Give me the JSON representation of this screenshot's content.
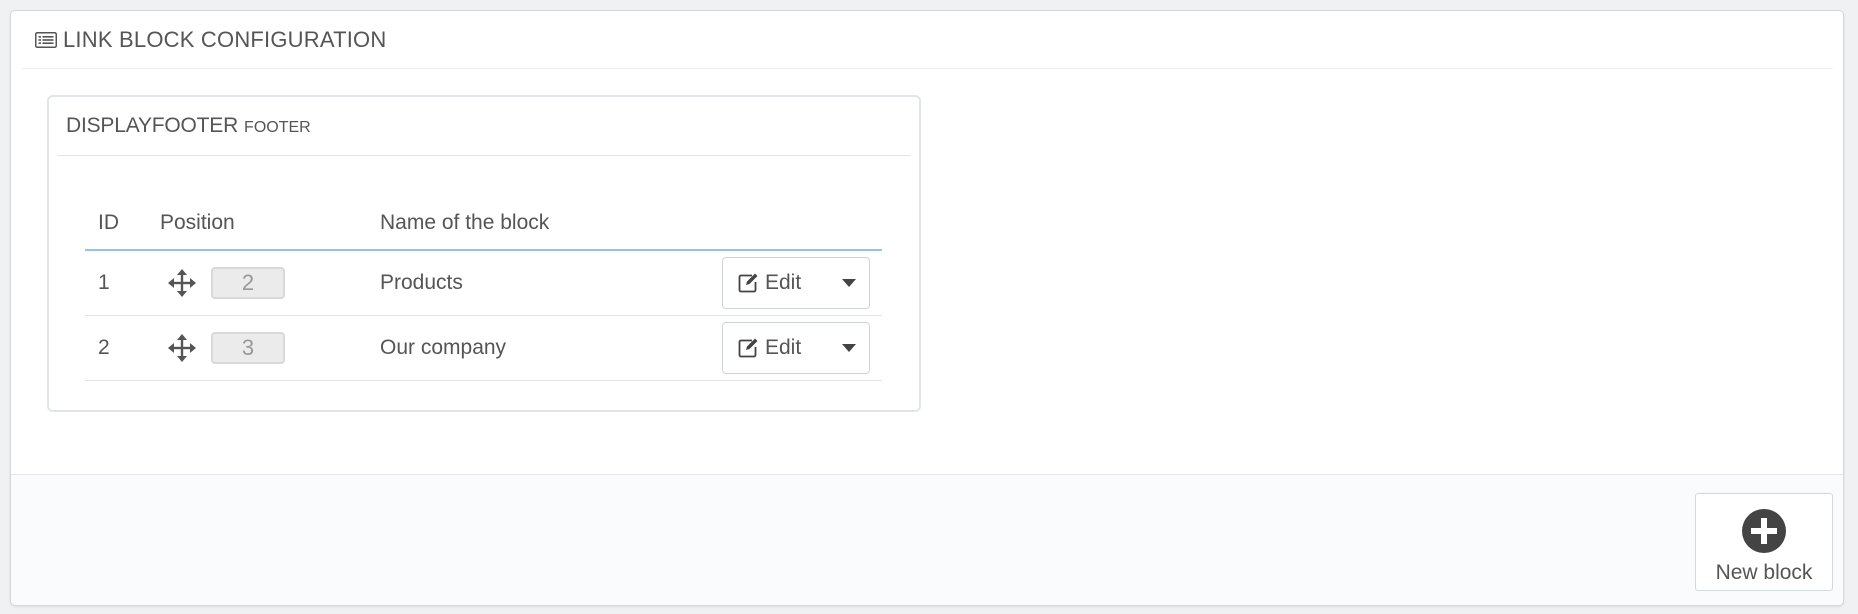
{
  "panel": {
    "title": "LINK BLOCK CONFIGURATION",
    "title_icon": "list-icon"
  },
  "hook_block": {
    "hook_name": "DISPLAYFOOTER",
    "hook_sub": "FOOTER",
    "table": {
      "headers": {
        "id": "ID",
        "position": "Position",
        "name": "Name of the block"
      },
      "rows": [
        {
          "id": "1",
          "position": "2",
          "name": "Products",
          "action": "Edit"
        },
        {
          "id": "2",
          "position": "3",
          "name": "Our company",
          "action": "Edit"
        }
      ]
    }
  },
  "footer": {
    "new_block_label": "New block",
    "new_block_icon": "plus-circle-icon"
  },
  "colors": {
    "header_underline": "#92c5e8",
    "text": "#555555",
    "icon_dark": "#444444"
  }
}
